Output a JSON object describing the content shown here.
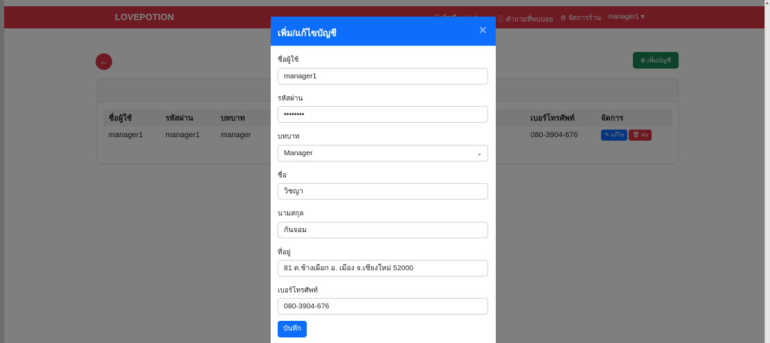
{
  "navbar": {
    "brand": "LOVEPOTION",
    "links": [
      "☐ บัญชี",
      "ⓘ ข้อมูล",
      "ⓘ คำถามที่พบบ่อย",
      "⚙ จัดการร้าน",
      "manager1 ▾"
    ]
  },
  "page": {
    "add_button": "⊕ เพิ่มบัญชี",
    "table": {
      "headers": [
        "ชื่อผู้ใช้",
        "รหัสผ่าน",
        "บทบาท",
        "เบอร์โทรศัพท์",
        "จัดการ"
      ],
      "rows": [
        {
          "username": "manager1",
          "password": "manager1",
          "role": "manager",
          "phone": "080-3904-676"
        }
      ],
      "edit_label": "✎ แก้ไข",
      "delete_label": "🗑 ลบ"
    }
  },
  "modal": {
    "title": "เพิ่ม/แก้ไขบัญชี",
    "close_glyph": "✕",
    "fields": {
      "username": {
        "label": "ชื่อผู้ใช้",
        "value": "manager1"
      },
      "password": {
        "label": "รหัสผ่าน",
        "value": "••••••••"
      },
      "role": {
        "label": "บทบาท",
        "value": "Manager"
      },
      "first_name": {
        "label": "ชื่อ",
        "value": "วิชญา"
      },
      "last_name": {
        "label": "นามสกุล",
        "value": "กันจอม"
      },
      "address": {
        "label": "ที่อยู่",
        "value": "81 ต.ช้างเผือก อ. เมือง จ.เชียงใหม่ 52000"
      },
      "phone": {
        "label": "เบอร์โทรศัพท์",
        "value": "080-3904-676"
      }
    },
    "save_label": "บันทึก"
  }
}
